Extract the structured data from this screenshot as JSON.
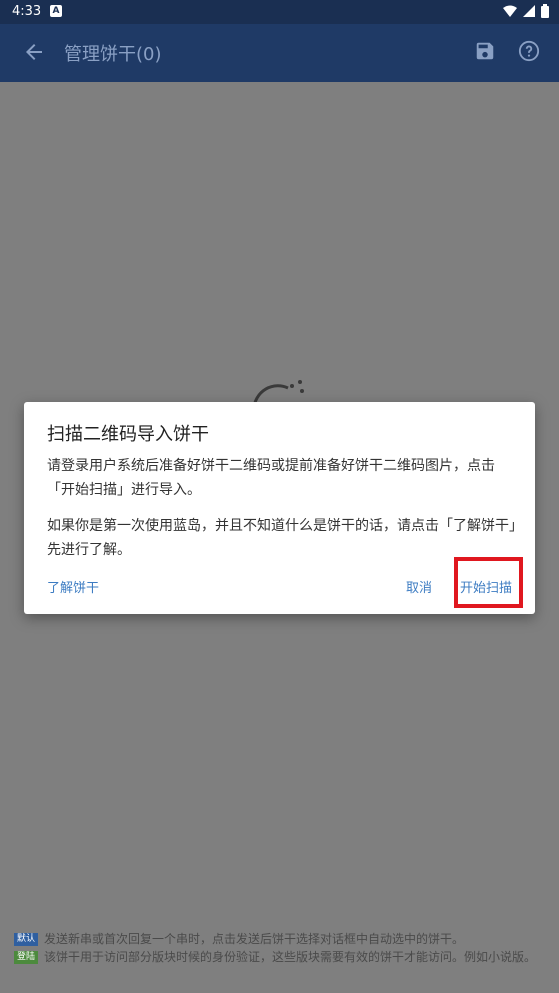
{
  "status_bar": {
    "time": "4:33",
    "notification_icon": "A"
  },
  "app_bar": {
    "title": "管理饼干(0)"
  },
  "dialog": {
    "title": "扫描二维码导入饼干",
    "paragraph1": "请登录用户系统后准备好饼干二维码或提前准备好饼干二维码图片，点击「开始扫描」进行导入。",
    "paragraph2": "如果你是第一次使用蓝岛，并且不知道什么是饼干的话，请点击「了解饼干」先进行了解。",
    "learn_label": "了解饼干",
    "cancel_label": "取消",
    "start_label": "开始扫描"
  },
  "notes": [
    {
      "badge": "默认",
      "text": "发送新串或首次回复一个串时，点击发送后饼干选择对话框中自动选中的饼干。"
    },
    {
      "badge": "登陆",
      "text": "该饼干用于访问部分版块时候的身份验证，这些版块需要有效的饼干才能访问。例如小说版。"
    }
  ],
  "colors": {
    "accent": "#3d7cc2",
    "highlight": "#e0171f",
    "app_bar": "#1f3a66"
  }
}
